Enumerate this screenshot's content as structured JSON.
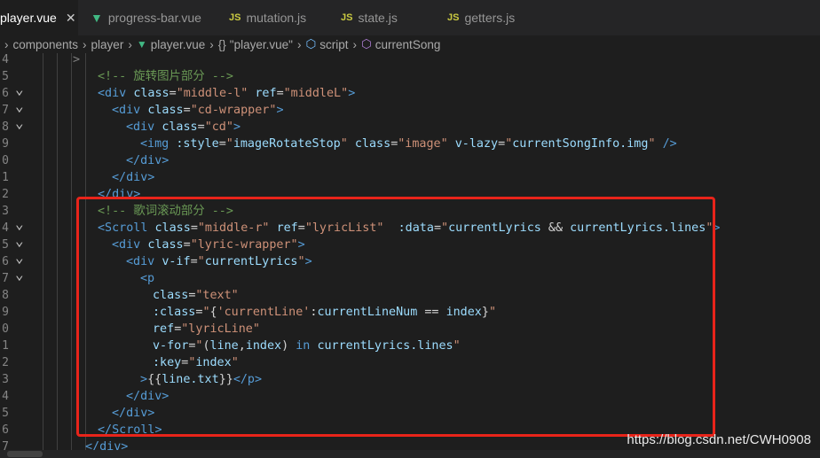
{
  "tabs": [
    {
      "icon": "vue-icon",
      "label": "player.vue",
      "active": true,
      "close": "✕"
    },
    {
      "icon": "vue-icon",
      "label": "progress-bar.vue"
    },
    {
      "icon": "js-icon",
      "prefix": "JS",
      "label": "mutation.js"
    },
    {
      "icon": "js-icon",
      "prefix": "JS",
      "label": "state.js"
    },
    {
      "icon": "js-icon",
      "prefix": "JS",
      "label": "getters.js"
    }
  ],
  "breadcrumb": {
    "items": [
      "components",
      "player",
      "player.vue",
      "\"player.vue\"",
      "script",
      "currentSong"
    ],
    "braces": "{}"
  },
  "code": {
    "line_numbers": [
      "4",
      "5",
      "6",
      "7",
      "8",
      "9",
      "0",
      "1",
      "2",
      "3",
      "4",
      "5",
      "6",
      "7",
      "8",
      "9",
      "0",
      "1",
      "2",
      "3",
      "4",
      "5",
      "6",
      "7"
    ],
    "folds": [
      "",
      "",
      "v",
      "v",
      "v",
      "",
      "",
      "",
      "",
      "",
      "v",
      "v",
      "v",
      "v",
      "",
      "",
      "",
      "",
      "",
      "",
      "",
      "",
      "",
      ""
    ],
    "lines": [
      [
        [
          "c-pun",
          ">"
        ]
      ],
      [
        [
          "c-com",
          "<!-- 旋转图片部分 -->"
        ]
      ],
      [
        [
          "c-tag",
          "<div"
        ],
        [
          "c-txt",
          " "
        ],
        [
          "c-attr",
          "class"
        ],
        [
          "c-txt",
          "="
        ],
        [
          "c-str",
          "\"middle-l\""
        ],
        [
          "c-txt",
          " "
        ],
        [
          "c-attr",
          "ref"
        ],
        [
          "c-txt",
          "="
        ],
        [
          "c-str",
          "\"middleL\""
        ],
        [
          "c-tag",
          ">"
        ]
      ],
      [
        [
          "c-tag",
          "<div"
        ],
        [
          "c-txt",
          " "
        ],
        [
          "c-attr",
          "class"
        ],
        [
          "c-txt",
          "="
        ],
        [
          "c-str",
          "\"cd-wrapper\""
        ],
        [
          "c-tag",
          ">"
        ]
      ],
      [
        [
          "c-tag",
          "<div"
        ],
        [
          "c-txt",
          " "
        ],
        [
          "c-attr",
          "class"
        ],
        [
          "c-txt",
          "="
        ],
        [
          "c-str",
          "\"cd\""
        ],
        [
          "c-tag",
          ">"
        ]
      ],
      [
        [
          "c-tag",
          "<img"
        ],
        [
          "c-txt",
          " "
        ],
        [
          "c-attr",
          ":style"
        ],
        [
          "c-txt",
          "="
        ],
        [
          "c-str",
          "\""
        ],
        [
          "c-attr",
          "imageRotateStop"
        ],
        [
          "c-str",
          "\""
        ],
        [
          "c-txt",
          " "
        ],
        [
          "c-attr",
          "class"
        ],
        [
          "c-txt",
          "="
        ],
        [
          "c-str",
          "\"image\""
        ],
        [
          "c-txt",
          " "
        ],
        [
          "c-attr",
          "v-lazy"
        ],
        [
          "c-txt",
          "="
        ],
        [
          "c-str",
          "\""
        ],
        [
          "c-attr",
          "currentSongInfo.img"
        ],
        [
          "c-str",
          "\""
        ],
        [
          "c-txt",
          " "
        ],
        [
          "c-tag",
          "/>"
        ]
      ],
      [
        [
          "c-tag",
          "</div>"
        ]
      ],
      [
        [
          "c-tag",
          "</div>"
        ]
      ],
      [
        [
          "c-tag",
          "</div>"
        ]
      ],
      [
        [
          "c-com",
          "<!-- 歌词滚动部分 -->"
        ]
      ],
      [
        [
          "c-tag",
          "<Scroll"
        ],
        [
          "c-txt",
          " "
        ],
        [
          "c-attr",
          "class"
        ],
        [
          "c-txt",
          "="
        ],
        [
          "c-str",
          "\"middle-r\""
        ],
        [
          "c-txt",
          " "
        ],
        [
          "c-attr",
          "ref"
        ],
        [
          "c-txt",
          "="
        ],
        [
          "c-str",
          "\"lyricList\""
        ],
        [
          "c-txt",
          "  "
        ],
        [
          "c-attr",
          ":data"
        ],
        [
          "c-txt",
          "="
        ],
        [
          "c-str",
          "\""
        ],
        [
          "c-attr",
          "currentLyrics"
        ],
        [
          "c-txt",
          " && "
        ],
        [
          "c-attr",
          "currentLyrics.lines"
        ],
        [
          "c-str",
          "\""
        ],
        [
          "c-tag",
          ">"
        ]
      ],
      [
        [
          "c-tag",
          "<div"
        ],
        [
          "c-txt",
          " "
        ],
        [
          "c-attr",
          "class"
        ],
        [
          "c-txt",
          "="
        ],
        [
          "c-str",
          "\"lyric-wrapper\""
        ],
        [
          "c-tag",
          ">"
        ]
      ],
      [
        [
          "c-tag",
          "<div"
        ],
        [
          "c-txt",
          " "
        ],
        [
          "c-attr",
          "v-if"
        ],
        [
          "c-txt",
          "="
        ],
        [
          "c-str",
          "\""
        ],
        [
          "c-attr",
          "currentLyrics"
        ],
        [
          "c-str",
          "\""
        ],
        [
          "c-tag",
          ">"
        ]
      ],
      [
        [
          "c-tag",
          "<p"
        ]
      ],
      [
        [
          "c-attr",
          "class"
        ],
        [
          "c-txt",
          "="
        ],
        [
          "c-str",
          "\"text\""
        ]
      ],
      [
        [
          "c-attr",
          ":class"
        ],
        [
          "c-txt",
          "="
        ],
        [
          "c-str",
          "\""
        ],
        [
          "c-txt",
          "{"
        ],
        [
          "c-str",
          "'currentLine'"
        ],
        [
          "c-txt",
          ":"
        ],
        [
          "c-attr",
          "currentLineNum"
        ],
        [
          "c-txt",
          " == "
        ],
        [
          "c-attr",
          "index"
        ],
        [
          "c-txt",
          "}"
        ],
        [
          "c-str",
          "\""
        ]
      ],
      [
        [
          "c-attr",
          "ref"
        ],
        [
          "c-txt",
          "="
        ],
        [
          "c-str",
          "\"lyricLine\""
        ]
      ],
      [
        [
          "c-attr",
          "v-for"
        ],
        [
          "c-txt",
          "="
        ],
        [
          "c-str",
          "\""
        ],
        [
          "c-txt",
          "("
        ],
        [
          "c-attr",
          "line"
        ],
        [
          "c-txt",
          ","
        ],
        [
          "c-attr",
          "index"
        ],
        [
          "c-txt",
          ") "
        ],
        [
          "c-tag",
          "in"
        ],
        [
          "c-txt",
          " "
        ],
        [
          "c-attr",
          "currentLyrics.lines"
        ],
        [
          "c-str",
          "\""
        ]
      ],
      [
        [
          "c-attr",
          ":key"
        ],
        [
          "c-txt",
          "="
        ],
        [
          "c-str",
          "\""
        ],
        [
          "c-attr",
          "index"
        ],
        [
          "c-str",
          "\""
        ]
      ],
      [
        [
          "c-tag",
          ">"
        ],
        [
          "c-txt",
          "{{"
        ],
        [
          "c-attr",
          "line.txt"
        ],
        [
          "c-txt",
          "}}"
        ],
        [
          "c-tag",
          "</p>"
        ]
      ],
      [
        [
          "c-tag",
          "</div>"
        ]
      ],
      [
        [
          "c-tag",
          "</div>"
        ]
      ],
      [
        [
          "c-tag",
          "</Scroll>"
        ]
      ],
      [
        [
          "c-tag",
          "</div>"
        ]
      ]
    ]
  },
  "watermark": "https://blog.csdn.net/CWH0908",
  "colors": {
    "highlight_border": "#e8241a",
    "comment": "#6a9955",
    "tag": "#569cd6",
    "attribute": "#9cdcfe",
    "string": "#ce9178"
  }
}
